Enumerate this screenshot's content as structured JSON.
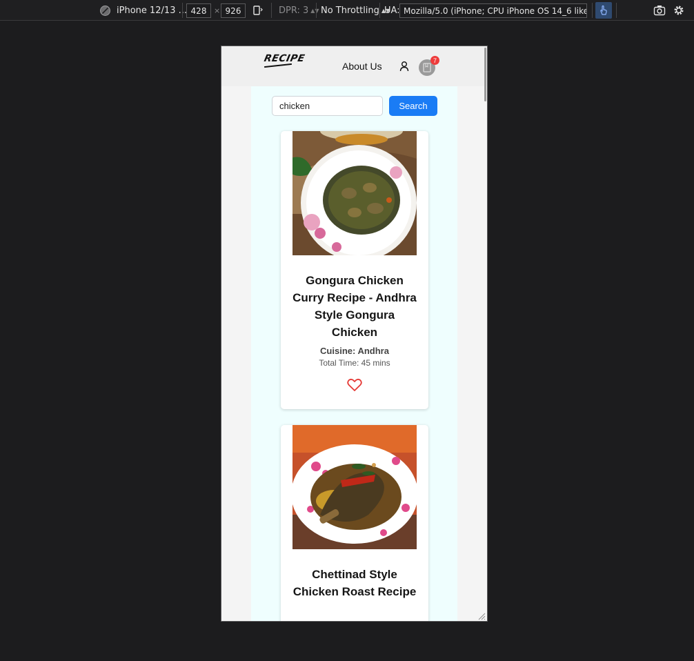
{
  "devtools": {
    "device": "iPhone 12/13 ...",
    "width": "428",
    "times": "×",
    "height": "926",
    "dpr": "DPR: 3",
    "throttling": "No Throttling",
    "ua_label": "UA:",
    "ua_value": "Mozilla/5.0 (iPhone; CPU iPhone OS 14_6 like Mac"
  },
  "navbar": {
    "logo": "RECIPE",
    "about": "About Us",
    "cart_count": "7"
  },
  "search": {
    "value": "chicken",
    "button": "Search"
  },
  "recipes": [
    {
      "title": "Gongura Chicken Curry Recipe - Andhra Style Gongura Chicken",
      "cuisine": "Cuisine: Andhra",
      "time": "Total Time: 45 mins"
    },
    {
      "title": "Chettinad Style Chicken Roast Recipe"
    }
  ],
  "colors": {
    "accent": "#1a7cf5",
    "badge": "#ee3b3b",
    "heart": "#e53935",
    "content_bg": "#effefe"
  }
}
